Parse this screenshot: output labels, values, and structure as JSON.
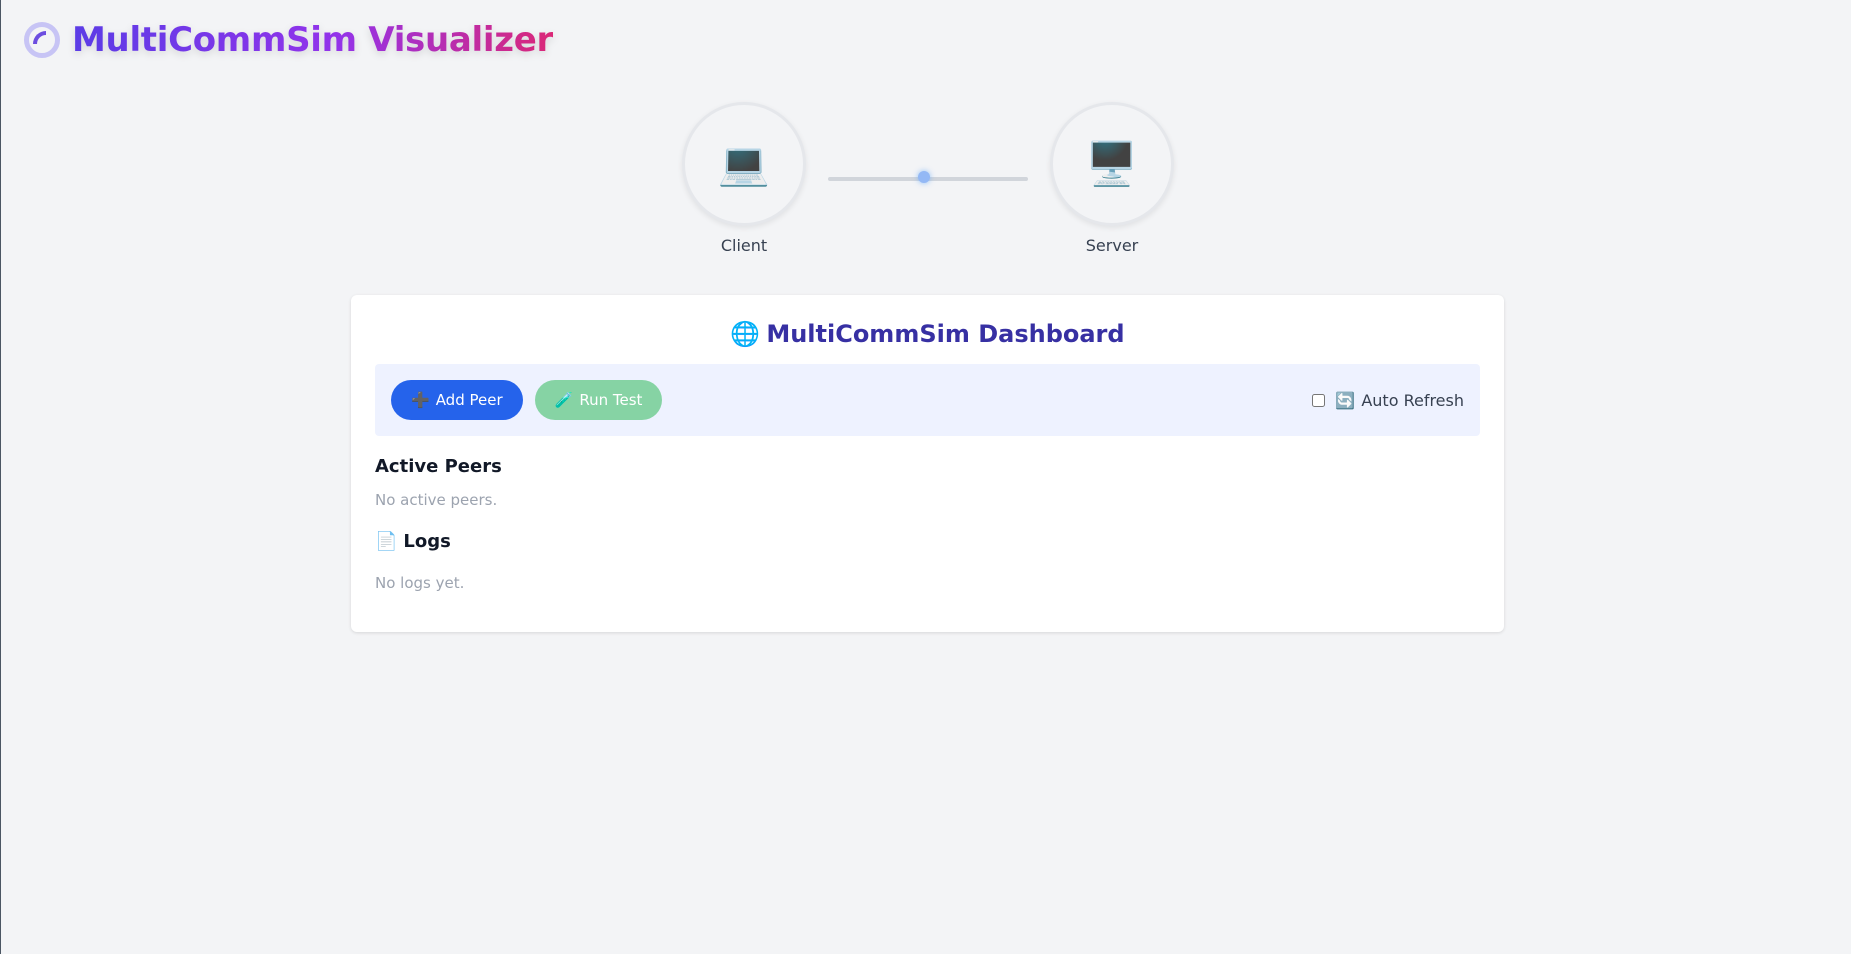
{
  "header": {
    "title": "MultiCommSim Visualizer",
    "logo_icon": "spinner-icon"
  },
  "topology": {
    "client": {
      "icon": "💻",
      "label": "Client"
    },
    "server": {
      "icon": "🖥️",
      "label": "Server"
    },
    "packet_progress": 0.48
  },
  "dashboard": {
    "title_icon": "🌐",
    "title": "MultiCommSim Dashboard",
    "toolbar": {
      "add_peer_icon": "➕",
      "add_peer_label": "Add Peer",
      "run_test_icon": "🧪",
      "run_test_label": "Run Test",
      "auto_refresh_icon": "🔄",
      "auto_refresh_label": "Auto Refresh",
      "auto_refresh_checked": false
    },
    "peers": {
      "heading": "Active Peers",
      "empty_text": "No active peers."
    },
    "logs": {
      "heading_icon": "📄",
      "heading": "Logs",
      "empty_text": "No logs yet."
    }
  },
  "colors": {
    "accent": "#3730a3",
    "primary_button": "#2563eb",
    "success_button": "#86d3a4",
    "toolbar_bg": "#eef2ff"
  }
}
